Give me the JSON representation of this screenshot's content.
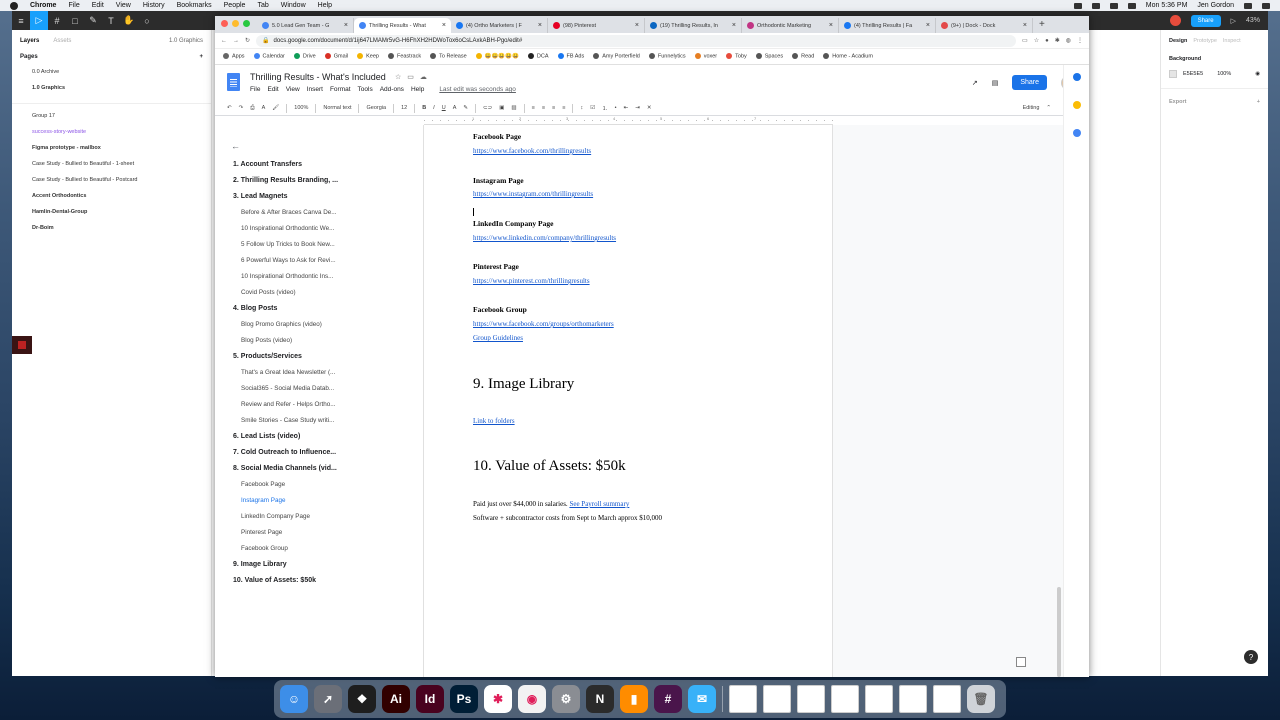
{
  "menubar": {
    "app": "Chrome",
    "items": [
      "File",
      "Edit",
      "View",
      "History",
      "Bookmarks",
      "People",
      "Tab",
      "Window",
      "Help"
    ],
    "time": "Mon 5:36 PM",
    "user": "Jen Gordon"
  },
  "figma": {
    "tabs": [
      "Layers",
      "Assets"
    ],
    "page_indicator": "1.0 Graphics",
    "pages_label": "Pages",
    "pages": [
      "0.0 Archive",
      "1.0 Graphics"
    ],
    "layers": [
      {
        "label": "Group 17",
        "style": ""
      },
      {
        "label": "success-story-website",
        "style": "purple"
      },
      {
        "label": "Figma prototype - mailbox",
        "style": "b"
      },
      {
        "label": "Case Study - Bullied to Beautiful - 1-sheet",
        "style": ""
      },
      {
        "label": "Case Study - Bullied to Beautiful - Postcard",
        "style": ""
      },
      {
        "label": "Accent Orthodontics",
        "style": "b"
      },
      {
        "label": "Hamlin-Dental-Group",
        "style": "b"
      },
      {
        "label": "Dr-Boim",
        "style": "b"
      }
    ],
    "right_tabs": [
      "Design",
      "Prototype",
      "Inspect"
    ],
    "background_label": "Background",
    "background_color": "E5E5E5",
    "background_opacity": "100%",
    "export_label": "Export",
    "share_label": "Share",
    "zoom": "43%"
  },
  "chrome": {
    "tabs": [
      {
        "title": "5.0 Lead Gen Team - G",
        "color": "#4285f4",
        "active": false
      },
      {
        "title": "Thrilling Results - What",
        "color": "#4285f4",
        "active": true
      },
      {
        "title": "(4) Ortho Marketers | F",
        "color": "#1877f2",
        "active": false
      },
      {
        "title": "(98) Pinterest",
        "color": "#e60023",
        "active": false
      },
      {
        "title": "(19) Thrilling Results, In",
        "color": "#0a66c2",
        "active": false
      },
      {
        "title": "Orthodontic Marketing",
        "color": "#c13584",
        "active": false
      },
      {
        "title": "(4) Thrilling Results | Fa",
        "color": "#1877f2",
        "active": false
      },
      {
        "title": "(9+) | Dock - Dock",
        "color": "#e34a4a",
        "active": false
      }
    ],
    "url": "docs.google.com/document/d/1ij647LMAMr5vG-H6FhXH2HDWoTox6oCsLAxkABH-Pgo/edit#",
    "bookmarks": [
      {
        "label": "Apps",
        "color": "#666"
      },
      {
        "label": "Calendar",
        "color": "#4285f4"
      },
      {
        "label": "Drive",
        "color": "#0f9d58"
      },
      {
        "label": "Gmail",
        "color": "#d93025"
      },
      {
        "label": "Keep",
        "color": "#f4b400"
      },
      {
        "label": "Feastrack",
        "color": "#555"
      },
      {
        "label": "To Release",
        "color": "#555"
      },
      {
        "label": "😀😀😀😀😀",
        "color": "#f4b400"
      },
      {
        "label": "DCA",
        "color": "#222"
      },
      {
        "label": "FB Ads",
        "color": "#1877f2"
      },
      {
        "label": "Amy Porterfield",
        "color": "#555"
      },
      {
        "label": "Funnelytics",
        "color": "#555"
      },
      {
        "label": "voxer",
        "color": "#e67e22"
      },
      {
        "label": "Toby",
        "color": "#e74c3c"
      },
      {
        "label": "Spaces",
        "color": "#555"
      },
      {
        "label": "Read",
        "color": "#555"
      },
      {
        "label": "Home - Acadium",
        "color": "#555"
      }
    ]
  },
  "docs": {
    "title": "Thrilling Results - What's Included",
    "menu": [
      "File",
      "Edit",
      "View",
      "Insert",
      "Format",
      "Tools",
      "Add-ons",
      "Help"
    ],
    "last_edit": "Last edit was seconds ago",
    "share": "Share",
    "toolbar": {
      "zoom": "100%",
      "style": "Normal text",
      "font": "Georgia",
      "size": "12",
      "mode": "Editing"
    },
    "ruler_marks": [
      "1",
      "2",
      "3",
      "4",
      "5",
      "6",
      "7"
    ],
    "outline": [
      {
        "text": "1. Account Transfers",
        "level": 1,
        "active": false
      },
      {
        "text": "2. Thrilling Results Branding, ...",
        "level": 1,
        "active": false
      },
      {
        "text": "3. Lead Magnets",
        "level": 1,
        "active": false
      },
      {
        "text": "Before & After Braces Canva De...",
        "level": 2,
        "active": false
      },
      {
        "text": "10 Inspirational Orthodontic We...",
        "level": 2,
        "active": false
      },
      {
        "text": "5 Follow Up Tricks to Book New...",
        "level": 2,
        "active": false
      },
      {
        "text": "6 Powerful Ways to Ask for Revi...",
        "level": 2,
        "active": false
      },
      {
        "text": "10 Inspirational Orthodontic Ins...",
        "level": 2,
        "active": false
      },
      {
        "text": "Covid Posts (video)",
        "level": 2,
        "active": false
      },
      {
        "text": "4. Blog Posts",
        "level": 1,
        "active": false
      },
      {
        "text": "Blog Promo Graphics (video)",
        "level": 2,
        "active": false
      },
      {
        "text": "Blog Posts (video)",
        "level": 2,
        "active": false
      },
      {
        "text": "5. Products/Services",
        "level": 1,
        "active": false
      },
      {
        "text": "That's a Great Idea Newsletter (...",
        "level": 2,
        "active": false
      },
      {
        "text": "Social365 - Social Media Datab...",
        "level": 2,
        "active": false
      },
      {
        "text": "Review and Refer - Helps Ortho...",
        "level": 2,
        "active": false
      },
      {
        "text": "Smile Stories - Case Study writi...",
        "level": 2,
        "active": false
      },
      {
        "text": "6. Lead Lists (video)",
        "level": 1,
        "active": false
      },
      {
        "text": "7. Cold Outreach to Influence...",
        "level": 1,
        "active": false
      },
      {
        "text": "8. Social Media Channels (vid...",
        "level": 1,
        "active": false
      },
      {
        "text": "Facebook Page",
        "level": 2,
        "active": false
      },
      {
        "text": "Instagram Page",
        "level": 2,
        "active": true
      },
      {
        "text": "LinkedIn Company Page",
        "level": 2,
        "active": false
      },
      {
        "text": "Pinterest Page",
        "level": 2,
        "active": false
      },
      {
        "text": "Facebook Group",
        "level": 2,
        "active": false
      },
      {
        "text": "9. Image Library",
        "level": 1,
        "active": false
      },
      {
        "text": "10. Value of Assets: $50k",
        "level": 1,
        "active": false
      }
    ],
    "body": {
      "fb_page_h": "Facebook Page",
      "fb_page_url": "https://www.facebook.com/thrillingresults",
      "ig_h": "Instagram Page",
      "ig_url": "https://www.instagram.com/thrillingresults",
      "li_h": "LinkedIn Company Page",
      "li_url": "https://www.linkedin.com/company/thrillingresults",
      "pin_h": "Pinterest Page",
      "pin_url": "https://www.pinterest.com/thrillingresults",
      "fbg_h": "Facebook Group",
      "fbg_url": "https://www.facebook.com/groups/orthomarketers",
      "fbg_guidelines": "Group Guidelines",
      "img_lib_h": "9. Image Library",
      "img_lib_link": "Link to folders",
      "value_h": "10. Value of Assets: $50k",
      "salaries": "Paid just over $44,000 in salaries.",
      "payroll_link": "See Payroll summary",
      "software": "Software + subcontractor costs from Sept to March approx $10,000"
    }
  },
  "dock": {
    "apps": [
      {
        "name": "finder",
        "color": "#3d8ee8",
        "glyph": "☺"
      },
      {
        "name": "launchpad",
        "color": "#6b6f78",
        "glyph": "➚"
      },
      {
        "name": "figma",
        "color": "#1e1e1e",
        "glyph": "❖"
      },
      {
        "name": "illustrator",
        "color": "#310000",
        "glyph": "Ai"
      },
      {
        "name": "indesign",
        "color": "#49021f",
        "glyph": "Id"
      },
      {
        "name": "photoshop",
        "color": "#001e36",
        "glyph": "Ps"
      },
      {
        "name": "slack",
        "color": "#ffffff",
        "glyph": "✱"
      },
      {
        "name": "chrome",
        "color": "#f2f2f2",
        "glyph": "◉"
      },
      {
        "name": "system-preferences",
        "color": "#8a8d93",
        "glyph": "⚙"
      },
      {
        "name": "notion",
        "color": "#2b2b2b",
        "glyph": "N"
      },
      {
        "name": "books",
        "color": "#ff8c00",
        "glyph": "▮"
      },
      {
        "name": "slack-alt",
        "color": "#4a154b",
        "glyph": "#"
      },
      {
        "name": "messages",
        "color": "#38b1f8",
        "glyph": "✉"
      }
    ]
  }
}
